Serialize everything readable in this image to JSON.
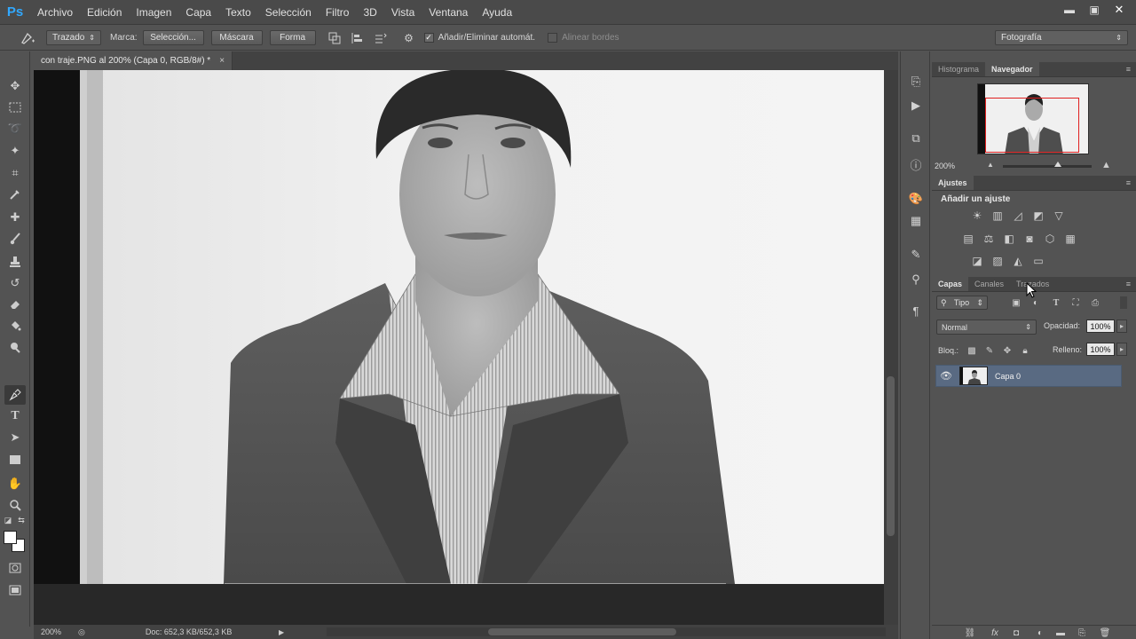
{
  "app": {
    "logo": "Ps"
  },
  "menu": [
    "Archivo",
    "Edición",
    "Imagen",
    "Capa",
    "Texto",
    "Selección",
    "Filtro",
    "3D",
    "Vista",
    "Ventana",
    "Ayuda"
  ],
  "window_controls": {
    "minimize": "▬",
    "restore": "▣",
    "close": "✕"
  },
  "options": {
    "mode_select": "Trazado",
    "marca_label": "Marca:",
    "btn_seleccion": "Selección...",
    "btn_mascara": "Máscara",
    "btn_forma": "Forma",
    "auto_add_delete": "Añadir/Eliminar automát.",
    "auto_add_delete_checked": true,
    "align_edges": "Alinear bordes",
    "align_edges_checked": false,
    "workspace": "Fotografía"
  },
  "document": {
    "tab_title": "con traje.PNG al 200% (Capa 0, RGB/8#) *",
    "close": "×"
  },
  "status": {
    "zoom": "200%",
    "doc_size": "Doc: 652,3 KB/652,3 KB"
  },
  "panels": {
    "top_tabs": [
      "Histograma",
      "Navegador"
    ],
    "top_active": "Navegador",
    "navigator_zoom": "200%",
    "adjustments_tab": "Ajustes",
    "adjustments_title": "Añadir un ajuste",
    "layers_tabs": [
      "Capas",
      "Canales",
      "Trazados"
    ],
    "layers_active": "Capas",
    "filter_kind": "Tipo",
    "blend_mode": "Normal",
    "opacity_label": "Opacidad:",
    "opacity_value": "100%",
    "lock_label": "Bloq.:",
    "fill_label": "Relleno:",
    "fill_value": "100%",
    "layers": [
      {
        "name": "Capa 0",
        "visible": true,
        "selected": true
      }
    ]
  }
}
